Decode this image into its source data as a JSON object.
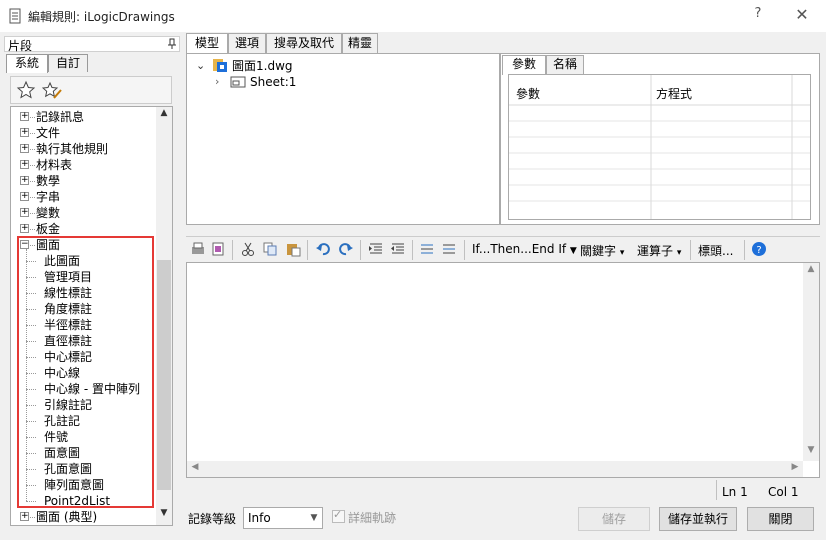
{
  "window": {
    "title": "編輯規則: iLogicDrawings",
    "help_label": "?",
    "close_label": "✕"
  },
  "left_panel": {
    "header": "片段",
    "pin": "ꟷ",
    "tabs": [
      "系統",
      "自訂"
    ],
    "tree_items": [
      {
        "label": "記錄訊息",
        "level": 0,
        "expander": "+"
      },
      {
        "label": "文件",
        "level": 0,
        "expander": "+"
      },
      {
        "label": "執行其他規則",
        "level": 0,
        "expander": "+"
      },
      {
        "label": "材料表",
        "level": 0,
        "expander": "+"
      },
      {
        "label": "數學",
        "level": 0,
        "expander": "+"
      },
      {
        "label": "字串",
        "level": 0,
        "expander": "+"
      },
      {
        "label": "變數",
        "level": 0,
        "expander": "+"
      },
      {
        "label": "板金",
        "level": 0,
        "expander": "+"
      },
      {
        "label": "圖面",
        "level": 0,
        "expander": "−"
      },
      {
        "label": "此圖面",
        "level": 1
      },
      {
        "label": "管理項目",
        "level": 1
      },
      {
        "label": "線性標註",
        "level": 1
      },
      {
        "label": "角度標註",
        "level": 1
      },
      {
        "label": "半徑標註",
        "level": 1
      },
      {
        "label": "直徑標註",
        "level": 1
      },
      {
        "label": "中心標記",
        "level": 1
      },
      {
        "label": "中心線",
        "level": 1
      },
      {
        "label": "中心線 - 置中陣列",
        "level": 1
      },
      {
        "label": "引線註記",
        "level": 1
      },
      {
        "label": "孔註記",
        "level": 1
      },
      {
        "label": "件號",
        "level": 1
      },
      {
        "label": "面意圖",
        "level": 1
      },
      {
        "label": "孔面意圖",
        "level": 1
      },
      {
        "label": "陣列面意圖",
        "level": 1
      },
      {
        "label": "Point2dList",
        "level": 1
      },
      {
        "label": "圖面 (典型)",
        "level": 0,
        "expander": "+"
      }
    ],
    "highlight_color": "#e53935"
  },
  "right_tabs": [
    "模型",
    "選項",
    "搜尋及取代",
    "精靈"
  ],
  "model_tree": {
    "root": "圖面1.dwg",
    "child": "Sheet:1"
  },
  "params": {
    "tabs": [
      "參數",
      "名稱"
    ],
    "columns": [
      "參數",
      "方程式"
    ]
  },
  "editor_toolbar": {
    "if_then": "If...Then...End If",
    "keywords": "關鍵字",
    "operators": "運算子",
    "header": "標頭..."
  },
  "status": {
    "line": "Ln 1",
    "col": "Col 1"
  },
  "bottom": {
    "log_label": "記錄等級",
    "log_value": "Info",
    "trace_label": "詳細軌跡",
    "save": "儲存",
    "save_run": "儲存並執行",
    "close": "關閉"
  },
  "colors": {
    "accent_blue": "#1e6fd9"
  }
}
